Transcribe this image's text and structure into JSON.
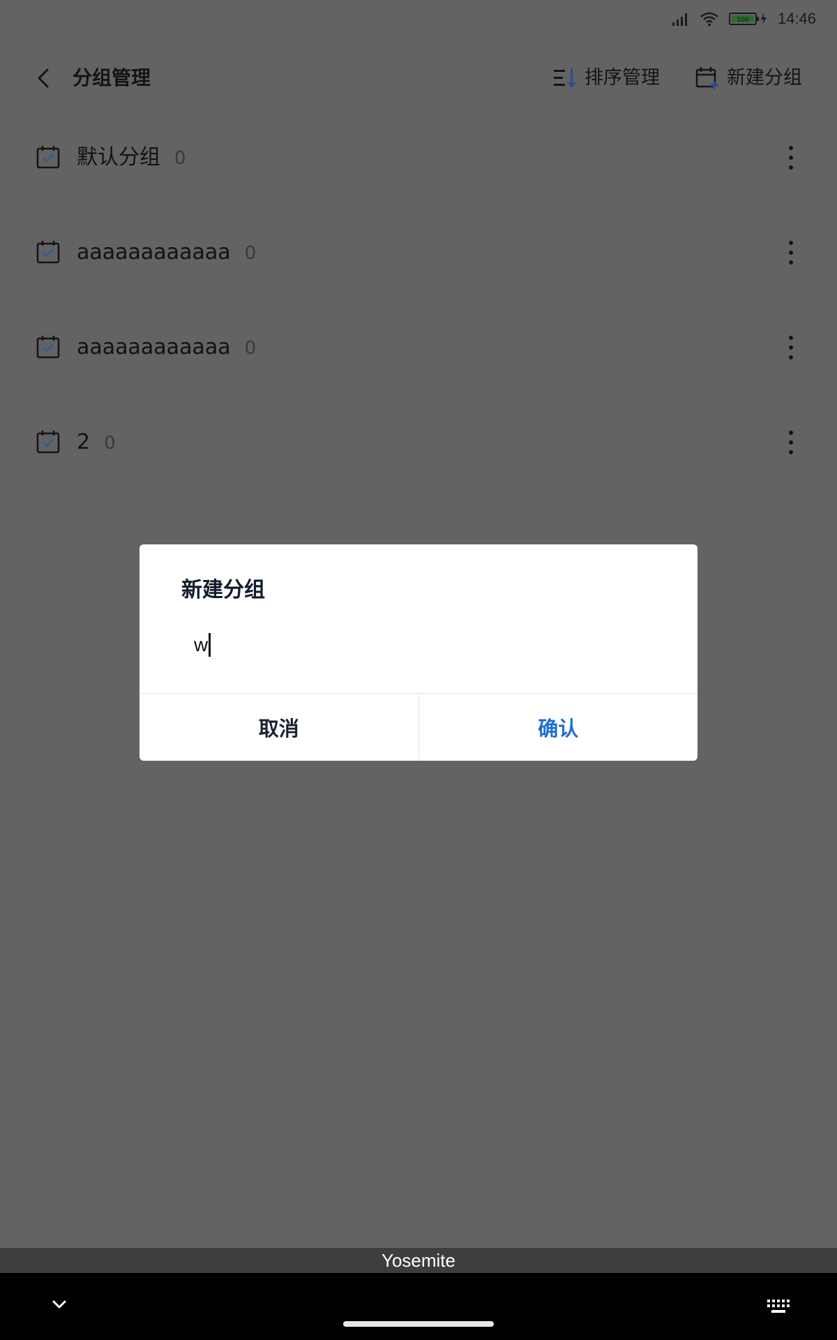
{
  "status_bar": {
    "time": "14:46",
    "battery_level": "100"
  },
  "header": {
    "title": "分组管理",
    "sort_label": "排序管理",
    "new_group_label": "新建分组"
  },
  "groups": [
    {
      "name": "默认分组",
      "count": "0"
    },
    {
      "name": "aaaaaaaaaaaa",
      "count": "0"
    },
    {
      "name": "aaaaaaaaaaaa",
      "count": "0"
    },
    {
      "name": "2",
      "count": "0"
    }
  ],
  "dialog": {
    "title": "新建分组",
    "input_value": "w",
    "cancel_label": "取消",
    "confirm_label": "确认"
  },
  "keyboard": {
    "suggestion": "Yosemite"
  },
  "colors": {
    "accent": "#1f6ed0",
    "overlay": "#636363",
    "icon_check": "#3a5a8c"
  }
}
